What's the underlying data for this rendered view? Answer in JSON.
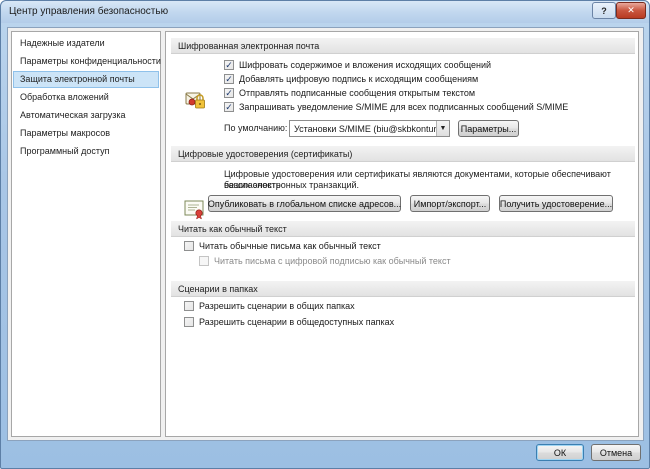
{
  "window": {
    "title": "Центр управления безопасностью",
    "help_glyph": "?",
    "close_glyph": "✕"
  },
  "sidebar": {
    "items": [
      {
        "label": "Надежные издатели"
      },
      {
        "label": "Параметры конфиденциальности"
      },
      {
        "label": "Защита электронной почты",
        "selected": true
      },
      {
        "label": "Обработка вложений"
      },
      {
        "label": "Автоматическая загрузка"
      },
      {
        "label": "Параметры макросов"
      },
      {
        "label": "Программный доступ"
      }
    ]
  },
  "encrypted_mail": {
    "header": "Шифрованная электронная почта",
    "icon": "lock-icon",
    "options": [
      {
        "label": "Шифровать содержимое и вложения исходящих сообщений",
        "checked": true
      },
      {
        "label": "Добавлять цифровую подпись к исходящим сообщениям",
        "checked": true
      },
      {
        "label": "Отправлять подписанные сообщения открытым текстом",
        "checked": true
      },
      {
        "label": "Запрашивать уведомление S/MIME для всех подписанных сообщений S/MIME",
        "checked": true
      }
    ],
    "default_label": "По умолчанию:",
    "default_value": "Установки S/MIME (biu@skbkontur.ru)",
    "params_button": "Параметры..."
  },
  "certificates": {
    "header": "Цифровые удостоверения (сертификаты)",
    "icon": "certificate-icon",
    "description_line1": "Цифровые удостоверения или сертификаты являются документами, которые обеспечивают безопасность",
    "description_line2": "ваших электронных транзакций.",
    "publish_button": "Опубликовать в глобальном списке адресов...",
    "import_button": "Импорт/экспорт...",
    "get_button": "Получить удостоверение..."
  },
  "plain_text": {
    "header": "Читать как обычный текст",
    "options": [
      {
        "label": "Читать обычные письма как обычный текст",
        "checked": false,
        "disabled": false
      },
      {
        "label": "Читать письма с цифровой подписью как обычный текст",
        "checked": false,
        "disabled": true
      }
    ]
  },
  "folder_scripts": {
    "header": "Сценарии в папках",
    "options": [
      {
        "label": "Разрешить сценарии в общих папках",
        "checked": false
      },
      {
        "label": "Разрешить сценарии в общедоступных папках",
        "checked": false
      }
    ]
  },
  "footer": {
    "ok": "ОК",
    "cancel": "Отмена"
  }
}
